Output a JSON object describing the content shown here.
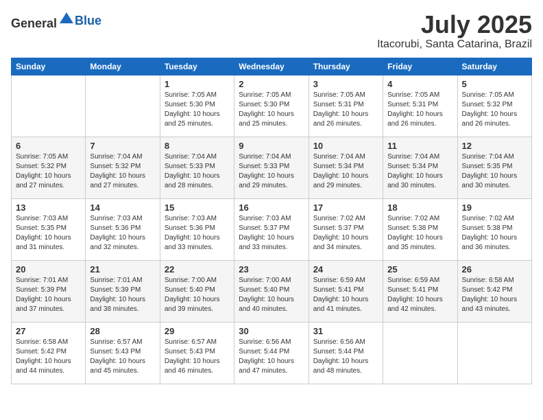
{
  "header": {
    "logo_general": "General",
    "logo_blue": "Blue",
    "month_year": "July 2025",
    "location": "Itacorubi, Santa Catarina, Brazil"
  },
  "days_of_week": [
    "Sunday",
    "Monday",
    "Tuesday",
    "Wednesday",
    "Thursday",
    "Friday",
    "Saturday"
  ],
  "weeks": [
    [
      {
        "day": "",
        "info": ""
      },
      {
        "day": "",
        "info": ""
      },
      {
        "day": "1",
        "info": "Sunrise: 7:05 AM\nSunset: 5:30 PM\nDaylight: 10 hours and 25 minutes."
      },
      {
        "day": "2",
        "info": "Sunrise: 7:05 AM\nSunset: 5:30 PM\nDaylight: 10 hours and 25 minutes."
      },
      {
        "day": "3",
        "info": "Sunrise: 7:05 AM\nSunset: 5:31 PM\nDaylight: 10 hours and 26 minutes."
      },
      {
        "day": "4",
        "info": "Sunrise: 7:05 AM\nSunset: 5:31 PM\nDaylight: 10 hours and 26 minutes."
      },
      {
        "day": "5",
        "info": "Sunrise: 7:05 AM\nSunset: 5:32 PM\nDaylight: 10 hours and 26 minutes."
      }
    ],
    [
      {
        "day": "6",
        "info": "Sunrise: 7:05 AM\nSunset: 5:32 PM\nDaylight: 10 hours and 27 minutes."
      },
      {
        "day": "7",
        "info": "Sunrise: 7:04 AM\nSunset: 5:32 PM\nDaylight: 10 hours and 27 minutes."
      },
      {
        "day": "8",
        "info": "Sunrise: 7:04 AM\nSunset: 5:33 PM\nDaylight: 10 hours and 28 minutes."
      },
      {
        "day": "9",
        "info": "Sunrise: 7:04 AM\nSunset: 5:33 PM\nDaylight: 10 hours and 29 minutes."
      },
      {
        "day": "10",
        "info": "Sunrise: 7:04 AM\nSunset: 5:34 PM\nDaylight: 10 hours and 29 minutes."
      },
      {
        "day": "11",
        "info": "Sunrise: 7:04 AM\nSunset: 5:34 PM\nDaylight: 10 hours and 30 minutes."
      },
      {
        "day": "12",
        "info": "Sunrise: 7:04 AM\nSunset: 5:35 PM\nDaylight: 10 hours and 30 minutes."
      }
    ],
    [
      {
        "day": "13",
        "info": "Sunrise: 7:03 AM\nSunset: 5:35 PM\nDaylight: 10 hours and 31 minutes."
      },
      {
        "day": "14",
        "info": "Sunrise: 7:03 AM\nSunset: 5:36 PM\nDaylight: 10 hours and 32 minutes."
      },
      {
        "day": "15",
        "info": "Sunrise: 7:03 AM\nSunset: 5:36 PM\nDaylight: 10 hours and 33 minutes."
      },
      {
        "day": "16",
        "info": "Sunrise: 7:03 AM\nSunset: 5:37 PM\nDaylight: 10 hours and 33 minutes."
      },
      {
        "day": "17",
        "info": "Sunrise: 7:02 AM\nSunset: 5:37 PM\nDaylight: 10 hours and 34 minutes."
      },
      {
        "day": "18",
        "info": "Sunrise: 7:02 AM\nSunset: 5:38 PM\nDaylight: 10 hours and 35 minutes."
      },
      {
        "day": "19",
        "info": "Sunrise: 7:02 AM\nSunset: 5:38 PM\nDaylight: 10 hours and 36 minutes."
      }
    ],
    [
      {
        "day": "20",
        "info": "Sunrise: 7:01 AM\nSunset: 5:39 PM\nDaylight: 10 hours and 37 minutes."
      },
      {
        "day": "21",
        "info": "Sunrise: 7:01 AM\nSunset: 5:39 PM\nDaylight: 10 hours and 38 minutes."
      },
      {
        "day": "22",
        "info": "Sunrise: 7:00 AM\nSunset: 5:40 PM\nDaylight: 10 hours and 39 minutes."
      },
      {
        "day": "23",
        "info": "Sunrise: 7:00 AM\nSunset: 5:40 PM\nDaylight: 10 hours and 40 minutes."
      },
      {
        "day": "24",
        "info": "Sunrise: 6:59 AM\nSunset: 5:41 PM\nDaylight: 10 hours and 41 minutes."
      },
      {
        "day": "25",
        "info": "Sunrise: 6:59 AM\nSunset: 5:41 PM\nDaylight: 10 hours and 42 minutes."
      },
      {
        "day": "26",
        "info": "Sunrise: 6:58 AM\nSunset: 5:42 PM\nDaylight: 10 hours and 43 minutes."
      }
    ],
    [
      {
        "day": "27",
        "info": "Sunrise: 6:58 AM\nSunset: 5:42 PM\nDaylight: 10 hours and 44 minutes."
      },
      {
        "day": "28",
        "info": "Sunrise: 6:57 AM\nSunset: 5:43 PM\nDaylight: 10 hours and 45 minutes."
      },
      {
        "day": "29",
        "info": "Sunrise: 6:57 AM\nSunset: 5:43 PM\nDaylight: 10 hours and 46 minutes."
      },
      {
        "day": "30",
        "info": "Sunrise: 6:56 AM\nSunset: 5:44 PM\nDaylight: 10 hours and 47 minutes."
      },
      {
        "day": "31",
        "info": "Sunrise: 6:56 AM\nSunset: 5:44 PM\nDaylight: 10 hours and 48 minutes."
      },
      {
        "day": "",
        "info": ""
      },
      {
        "day": "",
        "info": ""
      }
    ]
  ]
}
